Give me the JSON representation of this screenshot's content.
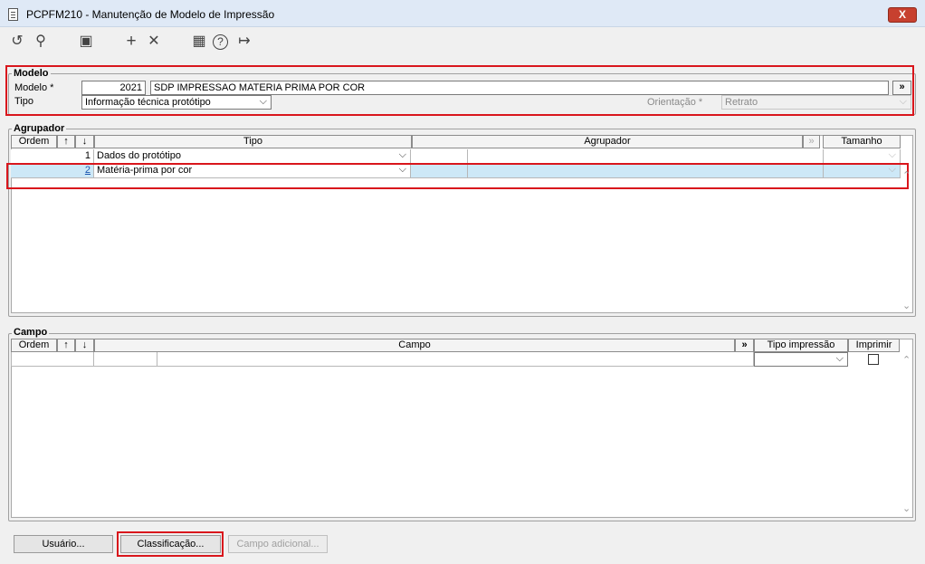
{
  "window": {
    "title": "PCPFM210 - Manutenção de Modelo de Impressão",
    "close_label": "X"
  },
  "toolbar": {
    "icons": [
      "undo-icon",
      "search-icon",
      "save-icon",
      "add-icon",
      "delete-icon",
      "calendar-icon",
      "help-icon",
      "exit-icon"
    ],
    "glyphs": {
      "undo": "↺",
      "search": "⚲",
      "save": "▣",
      "add": "+",
      "delete": "✕",
      "calendar": "▦",
      "help": "?",
      "exit": "↦"
    }
  },
  "modelo": {
    "section_title": "Modelo",
    "modelo_label": "Modelo *",
    "modelo_code": "2021",
    "modelo_desc": "SDP IMPRESSAO MATERIA PRIMA POR COR",
    "expand_label": "»",
    "tipo_label": "Tipo",
    "tipo_value": "Informação técnica protótipo",
    "orientacao_label": "Orientação *",
    "orientacao_value": "Retrato"
  },
  "agrupador": {
    "section_title": "Agrupador",
    "headers": {
      "ordem": "Ordem",
      "up": "↑",
      "down": "↓",
      "tipo": "Tipo",
      "agrupador": "Agrupador",
      "link": "»",
      "tamanho": "Tamanho"
    },
    "rows": [
      {
        "ordem": "1",
        "tipo": "Dados do protótipo"
      },
      {
        "ordem": "2",
        "tipo": "Matéria-prima por cor"
      }
    ]
  },
  "campo": {
    "section_title": "Campo",
    "headers": {
      "ordem": "Ordem",
      "up": "↑",
      "down": "↓",
      "campo": "Campo",
      "link": "»",
      "tipo_impressao": "Tipo impressão",
      "imprimir": "Imprimir"
    }
  },
  "footer": {
    "usuario_label": "Usuário...",
    "classificacao_label": "Classificação...",
    "campo_adicional_label": "Campo adicional..."
  },
  "colors": {
    "highlight": "#d9161c",
    "selection": "#cde8f7",
    "close": "#c7402f"
  }
}
